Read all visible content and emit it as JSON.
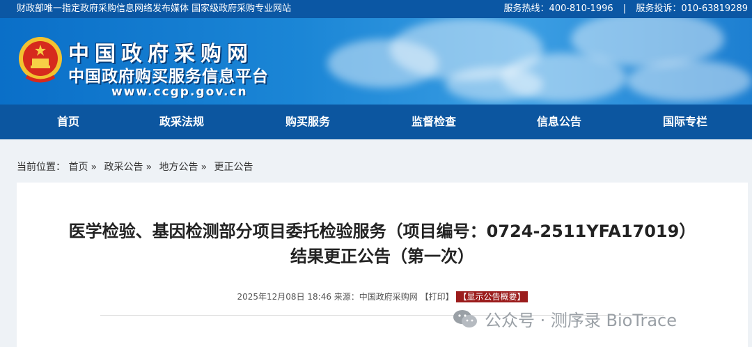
{
  "topbar": {
    "left_text": "财政部唯一指定政府采购信息网络发布媒体 国家级政府采购专业网站",
    "hotline": "服务热线：400-810-1996",
    "separator": "|",
    "complaint": "服务投诉：010-63819289"
  },
  "logo": {
    "title": "中国政府采购网",
    "subtitle": "中国政府购买服务信息平台",
    "url": "www.ccgp.gov.cn"
  },
  "nav": {
    "items": [
      "首页",
      "政采法规",
      "购买服务",
      "监督检查",
      "信息公告",
      "国际专栏"
    ]
  },
  "breadcrumb": {
    "prefix": "当前位置：",
    "items": [
      "首页",
      "政采公告",
      "地方公告",
      "更正公告"
    ],
    "arrow": "»"
  },
  "article": {
    "title_line1": "医学检验、基因检测部分项目委托检验服务（项目编号：0724-2511YFA17019）",
    "title_line2": "结果更正公告（第一次）",
    "date": "2025年12月08日 18:46",
    "source": "来源：中国政府采购网",
    "print": "【打印】",
    "summary_button": "【显示公告概要】"
  },
  "watermark": {
    "text": "公众号 · 测序录 BioTrace"
  },
  "colors": {
    "topbar": "#0b57a4",
    "nav": "#0c56a0",
    "badge": "#9b1c1c"
  }
}
